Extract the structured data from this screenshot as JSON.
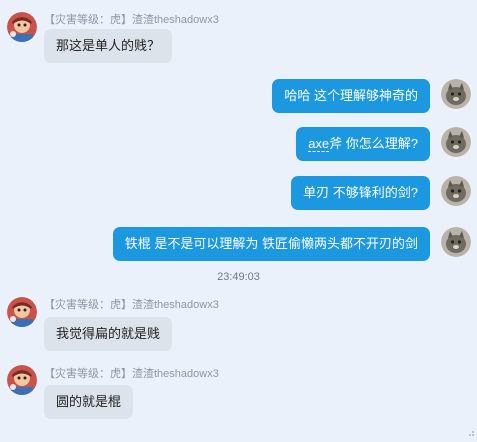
{
  "messages": [
    {
      "side": "in",
      "sender": "【灾害等级：虎】渣渣theshadowx3",
      "text": "那这是单人的贱？"
    },
    {
      "side": "out",
      "text": "哈哈  这个理解够神奇的"
    },
    {
      "side": "out",
      "text_prefix": "axe",
      "text_rest": "斧 你怎么理解?"
    },
    {
      "side": "out",
      "text": "单刃 不够锋利的剑?"
    },
    {
      "side": "out",
      "text": "铁棍 是不是可以理解为 铁匠偷懒两头都不开刃的剑"
    }
  ],
  "timestamp": "23:49:03",
  "messages_after": [
    {
      "side": "in",
      "sender": "【灾害等级：虎】渣渣theshadowx3",
      "text": "我觉得扁的就是贱"
    },
    {
      "side": "in",
      "sender": "【灾害等级：虎】渣渣theshadowx3",
      "text": "圆的就是棍"
    }
  ],
  "icons": {
    "them_avatar": "cartoon-character-avatar-icon",
    "me_avatar": "cat-avatar-icon"
  },
  "colors": {
    "background": "#eaf1fa",
    "out_bubble": "#1b98e0",
    "in_bubble": "#dde3ea"
  }
}
